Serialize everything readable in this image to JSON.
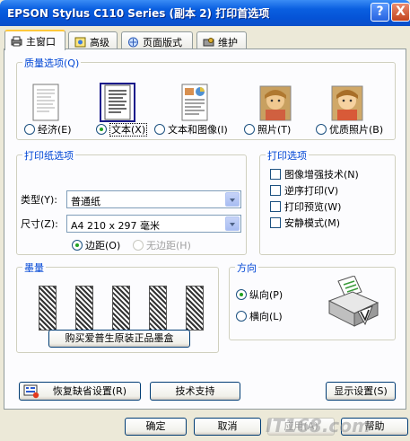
{
  "window": {
    "title": "EPSON Stylus C110 Series (副本 2) 打印首选项",
    "help_glyph": "?",
    "close_glyph": "X"
  },
  "tabs": [
    {
      "label": "主窗口",
      "active": true
    },
    {
      "label": "高级",
      "active": false
    },
    {
      "label": "页面版式",
      "active": false
    },
    {
      "label": "维护",
      "active": false
    }
  ],
  "quality": {
    "title": "质量选项(Q)",
    "options": [
      {
        "label": "经济(E)",
        "selected": false
      },
      {
        "label": "文本(X)",
        "selected": true
      },
      {
        "label": "文本和图像(I)",
        "selected": false
      },
      {
        "label": "照片(T)",
        "selected": false
      },
      {
        "label": "优质照片(B)",
        "selected": false
      }
    ]
  },
  "paper": {
    "title": "打印纸选项",
    "type_label": "类型(Y):",
    "type_value": "普通纸",
    "size_label": "尺寸(Z):",
    "size_value": "A4 210 x 297 毫米",
    "margin_options": [
      {
        "label": "边距(O)",
        "selected": true,
        "disabled": false
      },
      {
        "label": "无边距(H)",
        "selected": false,
        "disabled": true
      }
    ]
  },
  "print_options": {
    "title": "打印选项",
    "items": [
      {
        "label": "图像增强技术(N)",
        "checked": false
      },
      {
        "label": "逆序打印(V)",
        "checked": false
      },
      {
        "label": "打印预览(W)",
        "checked": false
      },
      {
        "label": "安静模式(M)",
        "checked": false
      }
    ]
  },
  "ink": {
    "title": "墨量",
    "cartridge_count": 5,
    "buy_button": "购买爱普生原装正品墨盒"
  },
  "orientation": {
    "title": "方向",
    "options": [
      {
        "label": "纵向(P)",
        "selected": true
      },
      {
        "label": "横向(L)",
        "selected": false
      }
    ]
  },
  "bottom": {
    "restore_button": "恢复缺省设置(R)",
    "support_button": "技术支持",
    "display_button": "显示设置(S)"
  },
  "dialog": {
    "ok": "确定",
    "cancel": "取消",
    "apply": "应用(A)",
    "help": "帮助"
  },
  "watermark": "IT168.com",
  "colors": {
    "accent_blue": "#0046D5",
    "titlebar": "#0553D6",
    "dialog_bg": "#ECE9D8",
    "tab_highlight": "#FFC83C"
  }
}
